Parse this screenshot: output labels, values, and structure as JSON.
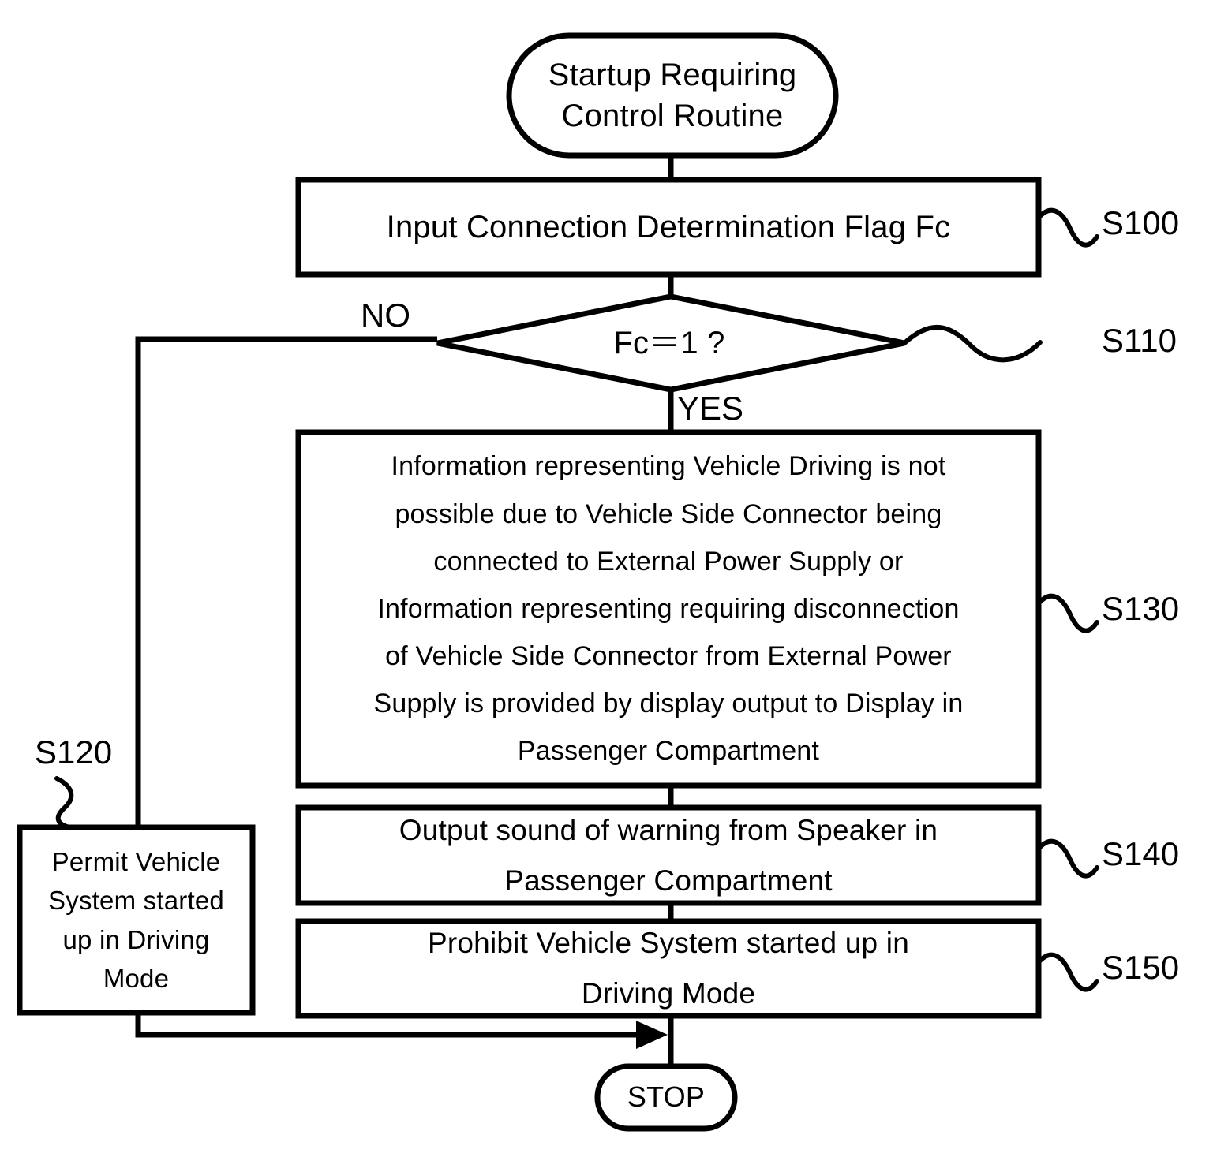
{
  "figure": {
    "type": "flowchart",
    "orientation": "top-to-bottom",
    "line_color": "#000000",
    "background_color": "#ffffff"
  },
  "nodes": {
    "start_terminal": {
      "shape": "stadium",
      "text": "Startup Requiring\nControl Routine"
    },
    "s100_box": {
      "shape": "rectangle",
      "text": "Input Connection Determination Flag Fc",
      "step": "S100"
    },
    "decision": {
      "shape": "diamond",
      "text": "Fc＝1 ?",
      "step": "S110",
      "branch_no": "NO",
      "branch_yes": "YES"
    },
    "s130_box": {
      "shape": "rectangle",
      "text": "Information representing Vehicle Driving is not\npossible due to Vehicle Side Connector being\nconnected to External Power Supply or\nInformation representing requiring disconnection\nof Vehicle Side Connector from External Power\nSupply is provided by display output to Display in\nPassenger Compartment",
      "step": "S130"
    },
    "s140_box": {
      "shape": "rectangle",
      "text": "Output sound of warning from Speaker in\nPassenger Compartment",
      "step": "S140"
    },
    "s150_box": {
      "shape": "rectangle",
      "text": "Prohibit Vehicle System started up in\nDriving Mode",
      "step": "S150"
    },
    "s120_box": {
      "shape": "rectangle",
      "text": "Permit Vehicle\nSystem started\nup in Driving\nMode",
      "step": "S120"
    },
    "stop_terminal": {
      "shape": "stadium",
      "text": "STOP"
    }
  },
  "step_labels": {
    "s100": "S100",
    "s110": "S110",
    "s120": "S120",
    "s130": "S130",
    "s140": "S140",
    "s150": "S150"
  },
  "branch_labels": {
    "no": "NO",
    "yes": "YES"
  }
}
